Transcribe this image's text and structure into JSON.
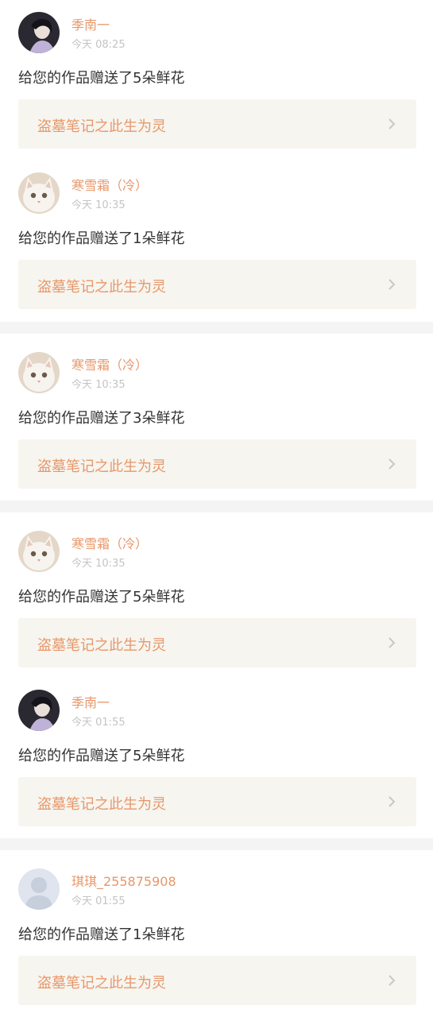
{
  "colors": {
    "accent": "#e8976a",
    "text": "#333333",
    "muted": "#c4c4c4",
    "work_bg": "#f6f5ef",
    "separator_bg": "#f4f4f4"
  },
  "notifications": [
    {
      "user_name": "季南一",
      "time": "今天 08:25",
      "message": "给您的作品赠送了5朵鲜花",
      "work_title": "盗墓笔记之此生为灵",
      "avatar_icon": "person-avatar-icon"
    },
    {
      "user_name": "寒雪霜（冷）",
      "time": "今天 10:35",
      "message": "给您的作品赠送了1朵鲜花",
      "work_title": "盗墓笔记之此生为灵",
      "avatar_icon": "white-cat-avatar-icon"
    },
    {
      "user_name": "寒雪霜（冷）",
      "time": "今天 10:35",
      "message": "给您的作品赠送了3朵鲜花",
      "work_title": "盗墓笔记之此生为灵",
      "avatar_icon": "white-cat-avatar-icon"
    },
    {
      "user_name": "寒雪霜（冷）",
      "time": "今天 10:35",
      "message": "给您的作品赠送了5朵鲜花",
      "work_title": "盗墓笔记之此生为灵",
      "avatar_icon": "white-cat-avatar-icon"
    },
    {
      "user_name": "季南一",
      "time": "今天 01:55",
      "message": "给您的作品赠送了5朵鲜花",
      "work_title": "盗墓笔记之此生为灵",
      "avatar_icon": "person-avatar-icon"
    },
    {
      "user_name": "琪琪_255875908",
      "time": "今天 01:55",
      "message": "给您的作品赠送了1朵鲜花",
      "work_title": "盗墓笔记之此生为灵",
      "avatar_icon": "default-user-avatar-icon"
    }
  ]
}
